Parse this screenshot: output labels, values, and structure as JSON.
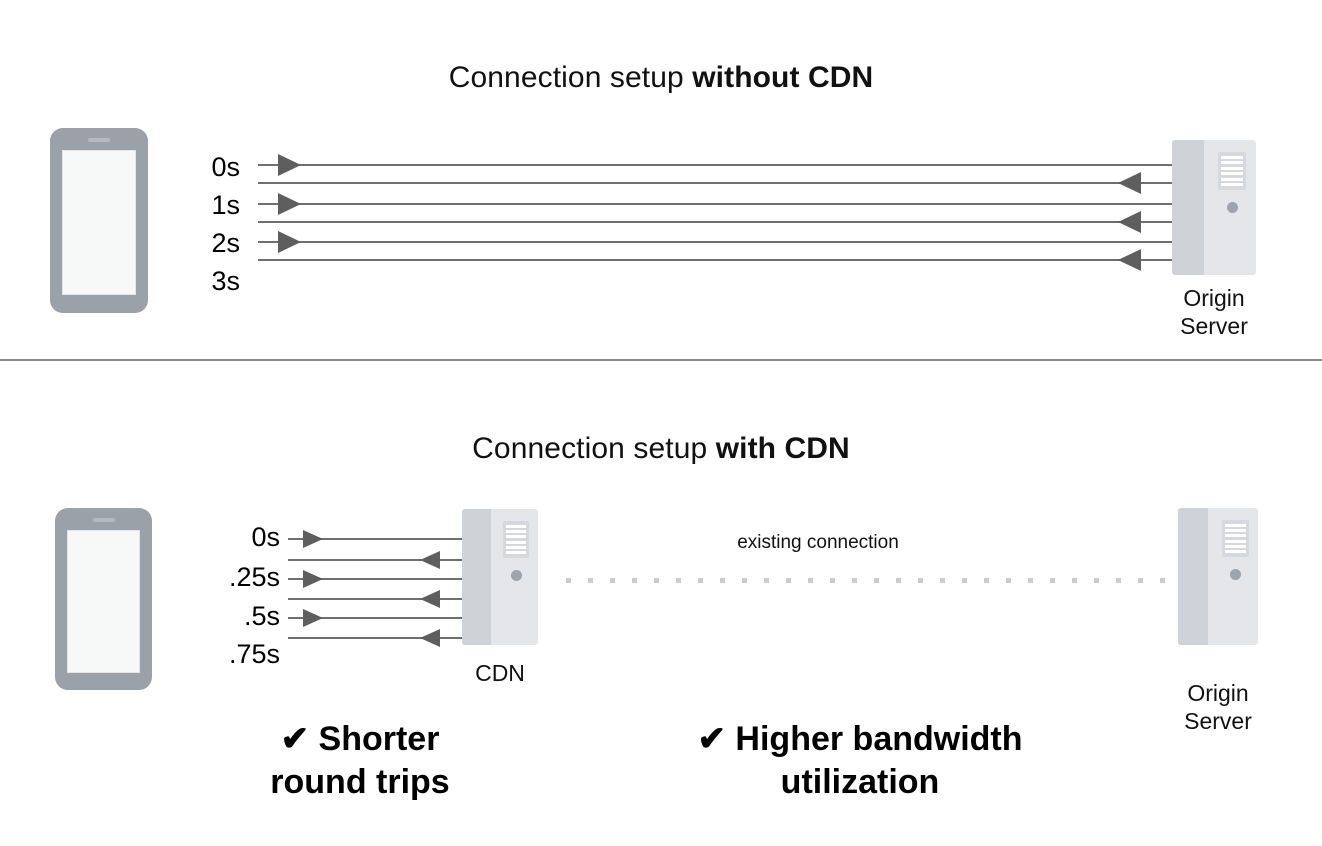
{
  "figure": {
    "background": "#ffffff",
    "line_color": "#6f6f6f",
    "arrow_color": "#5e5e5e",
    "server_color": "#e4e6e9",
    "phone_color": "#9aa1a9",
    "dotted_color": "#c9cdd2"
  },
  "sections": {
    "top": {
      "title_plain": "Connection setup ",
      "title_strong": "without CDN",
      "time_labels": [
        "0s",
        "1s",
        "2s",
        "3s"
      ],
      "phone_name": "smartphone",
      "server_label": "Origin\nServer",
      "rows": [
        {
          "direction": "right"
        },
        {
          "direction": "left"
        },
        {
          "direction": "right"
        },
        {
          "direction": "left"
        },
        {
          "direction": "right"
        },
        {
          "direction": "left"
        }
      ]
    },
    "bottom": {
      "title_plain": "Connection setup ",
      "title_strong": "with CDN",
      "time_labels": [
        "0s",
        ".25s",
        ".5s",
        ".75s"
      ],
      "phone_name": "smartphone",
      "cdn_label": "CDN",
      "origin_label": "Origin\nServer",
      "existing_connection_label": "existing connection",
      "rows": [
        {
          "direction": "right"
        },
        {
          "direction": "left"
        },
        {
          "direction": "right"
        },
        {
          "direction": "left"
        },
        {
          "direction": "right"
        },
        {
          "direction": "left"
        }
      ]
    }
  },
  "benefits": [
    {
      "check": "✔",
      "text": "Shorter\nround trips"
    },
    {
      "check": "✔",
      "text": "Higher bandwidth\nutilization"
    }
  ]
}
